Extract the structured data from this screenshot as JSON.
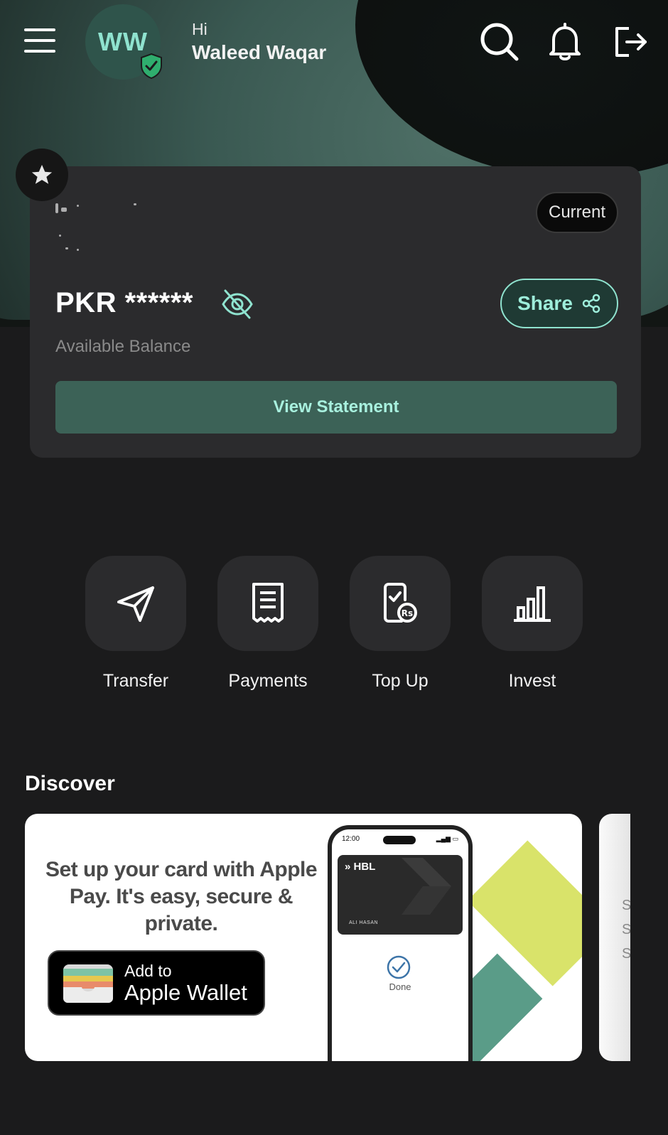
{
  "header": {
    "avatar_initials": "WW",
    "greeting": "Hi",
    "user_name": "Waleed Waqar",
    "icons": [
      "menu-icon",
      "verified-shield-icon",
      "search-icon",
      "bell-icon",
      "logout-icon"
    ]
  },
  "account_card": {
    "account_type_badge": "Current",
    "currency": "PKR",
    "masked_balance": "******",
    "balance_text": "PKR ******",
    "balance_label": "Available Balance",
    "share_label": "Share",
    "view_statement_label": "View Statement"
  },
  "quick_actions": [
    {
      "label": "Transfer",
      "icon": "send-icon"
    },
    {
      "label": "Payments",
      "icon": "receipt-icon"
    },
    {
      "label": "Top Up",
      "icon": "mobile-topup-icon"
    },
    {
      "label": "Invest",
      "icon": "bar-chart-icon"
    }
  ],
  "discover": {
    "title": "Discover",
    "promo": {
      "headline": "Set up your card with Apple Pay. It's easy, secure & private.",
      "wallet_add": "Add to",
      "wallet_name": "Apple Wallet",
      "phone_time": "12:00",
      "card_brand": "HBL",
      "card_holder": "ALI HASAN",
      "done_label": "Done"
    },
    "next_card_letters": [
      "S",
      "S",
      "S"
    ]
  },
  "colors": {
    "background": "#1b1b1c",
    "card": "#2b2b2d",
    "accent": "#8fe3cf",
    "button": "#3c6257"
  }
}
